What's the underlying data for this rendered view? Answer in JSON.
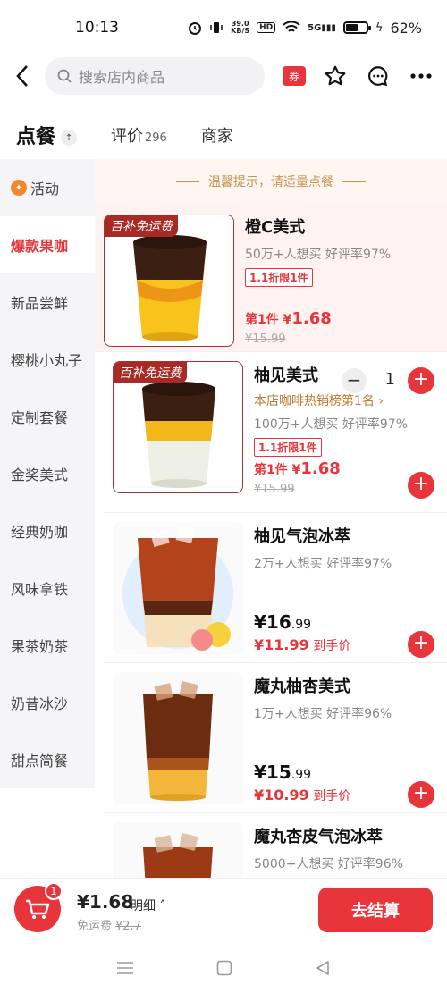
{
  "status": {
    "time": "10:13",
    "net_speed": "39.0",
    "net_unit": "KB/S",
    "hd": "HD",
    "signal": "5G",
    "battery": "62%",
    "battery_level": 0.62
  },
  "header": {
    "search_placeholder": "搜索店内商品",
    "coupon": "券"
  },
  "tabs": {
    "order": "点餐",
    "reviews": "评价",
    "reviews_count": "296",
    "merchant": "商家"
  },
  "sidebar": {
    "items": [
      {
        "label": "活动"
      },
      {
        "label": "爆款果咖"
      },
      {
        "label": "新品尝鲜"
      },
      {
        "label": "樱桃小丸子"
      },
      {
        "label": "定制套餐"
      },
      {
        "label": "金奖美式"
      },
      {
        "label": "经典奶咖"
      },
      {
        "label": "风味拿铁"
      },
      {
        "label": "果茶奶茶"
      },
      {
        "label": "奶昔冰沙"
      },
      {
        "label": "甜点简餐"
      }
    ]
  },
  "tip": "温馨提示，请适量点餐",
  "products": [
    {
      "name": "橙C美式",
      "badge": "百补免运费",
      "meta": "50万+人想买  好评率97%",
      "limit": "1.1折限1件",
      "price_prefix": "第1件 ¥",
      "price": "1.68",
      "original": "¥15.99",
      "qty": "1"
    },
    {
      "name": "柚见美式",
      "badge": "百补免运费",
      "rank": "本店咖啡热销榜第1名 ›",
      "meta": "100万+人想买  好评率97%",
      "limit": "1.1折限1件",
      "price_prefix": "第1件 ¥",
      "price": "1.68",
      "original": "¥15.99"
    },
    {
      "name": "柚见气泡冰萃",
      "meta": "2万+人想买  好评率97%",
      "price_int": "¥16",
      "price_dec": ".99",
      "net": "¥11.99",
      "net_suffix": " 到手价"
    },
    {
      "name": "魔丸柚杏美式",
      "meta": "1万+人想买  好评率96%",
      "price_int": "¥15",
      "price_dec": ".99",
      "net": "¥10.99",
      "net_suffix": " 到手价"
    },
    {
      "name": "魔丸杏皮气泡冰萃",
      "meta": "5000+人想买  好评率96%"
    }
  ],
  "bottom": {
    "cart_count": "1",
    "total": "¥1.68",
    "detail": "明细 ˄",
    "free_ship": "免运费",
    "free_ship_orig": "¥2.7",
    "checkout": "去结算"
  },
  "colors": {
    "accent": "#e8343b",
    "gold": "#c59150"
  }
}
